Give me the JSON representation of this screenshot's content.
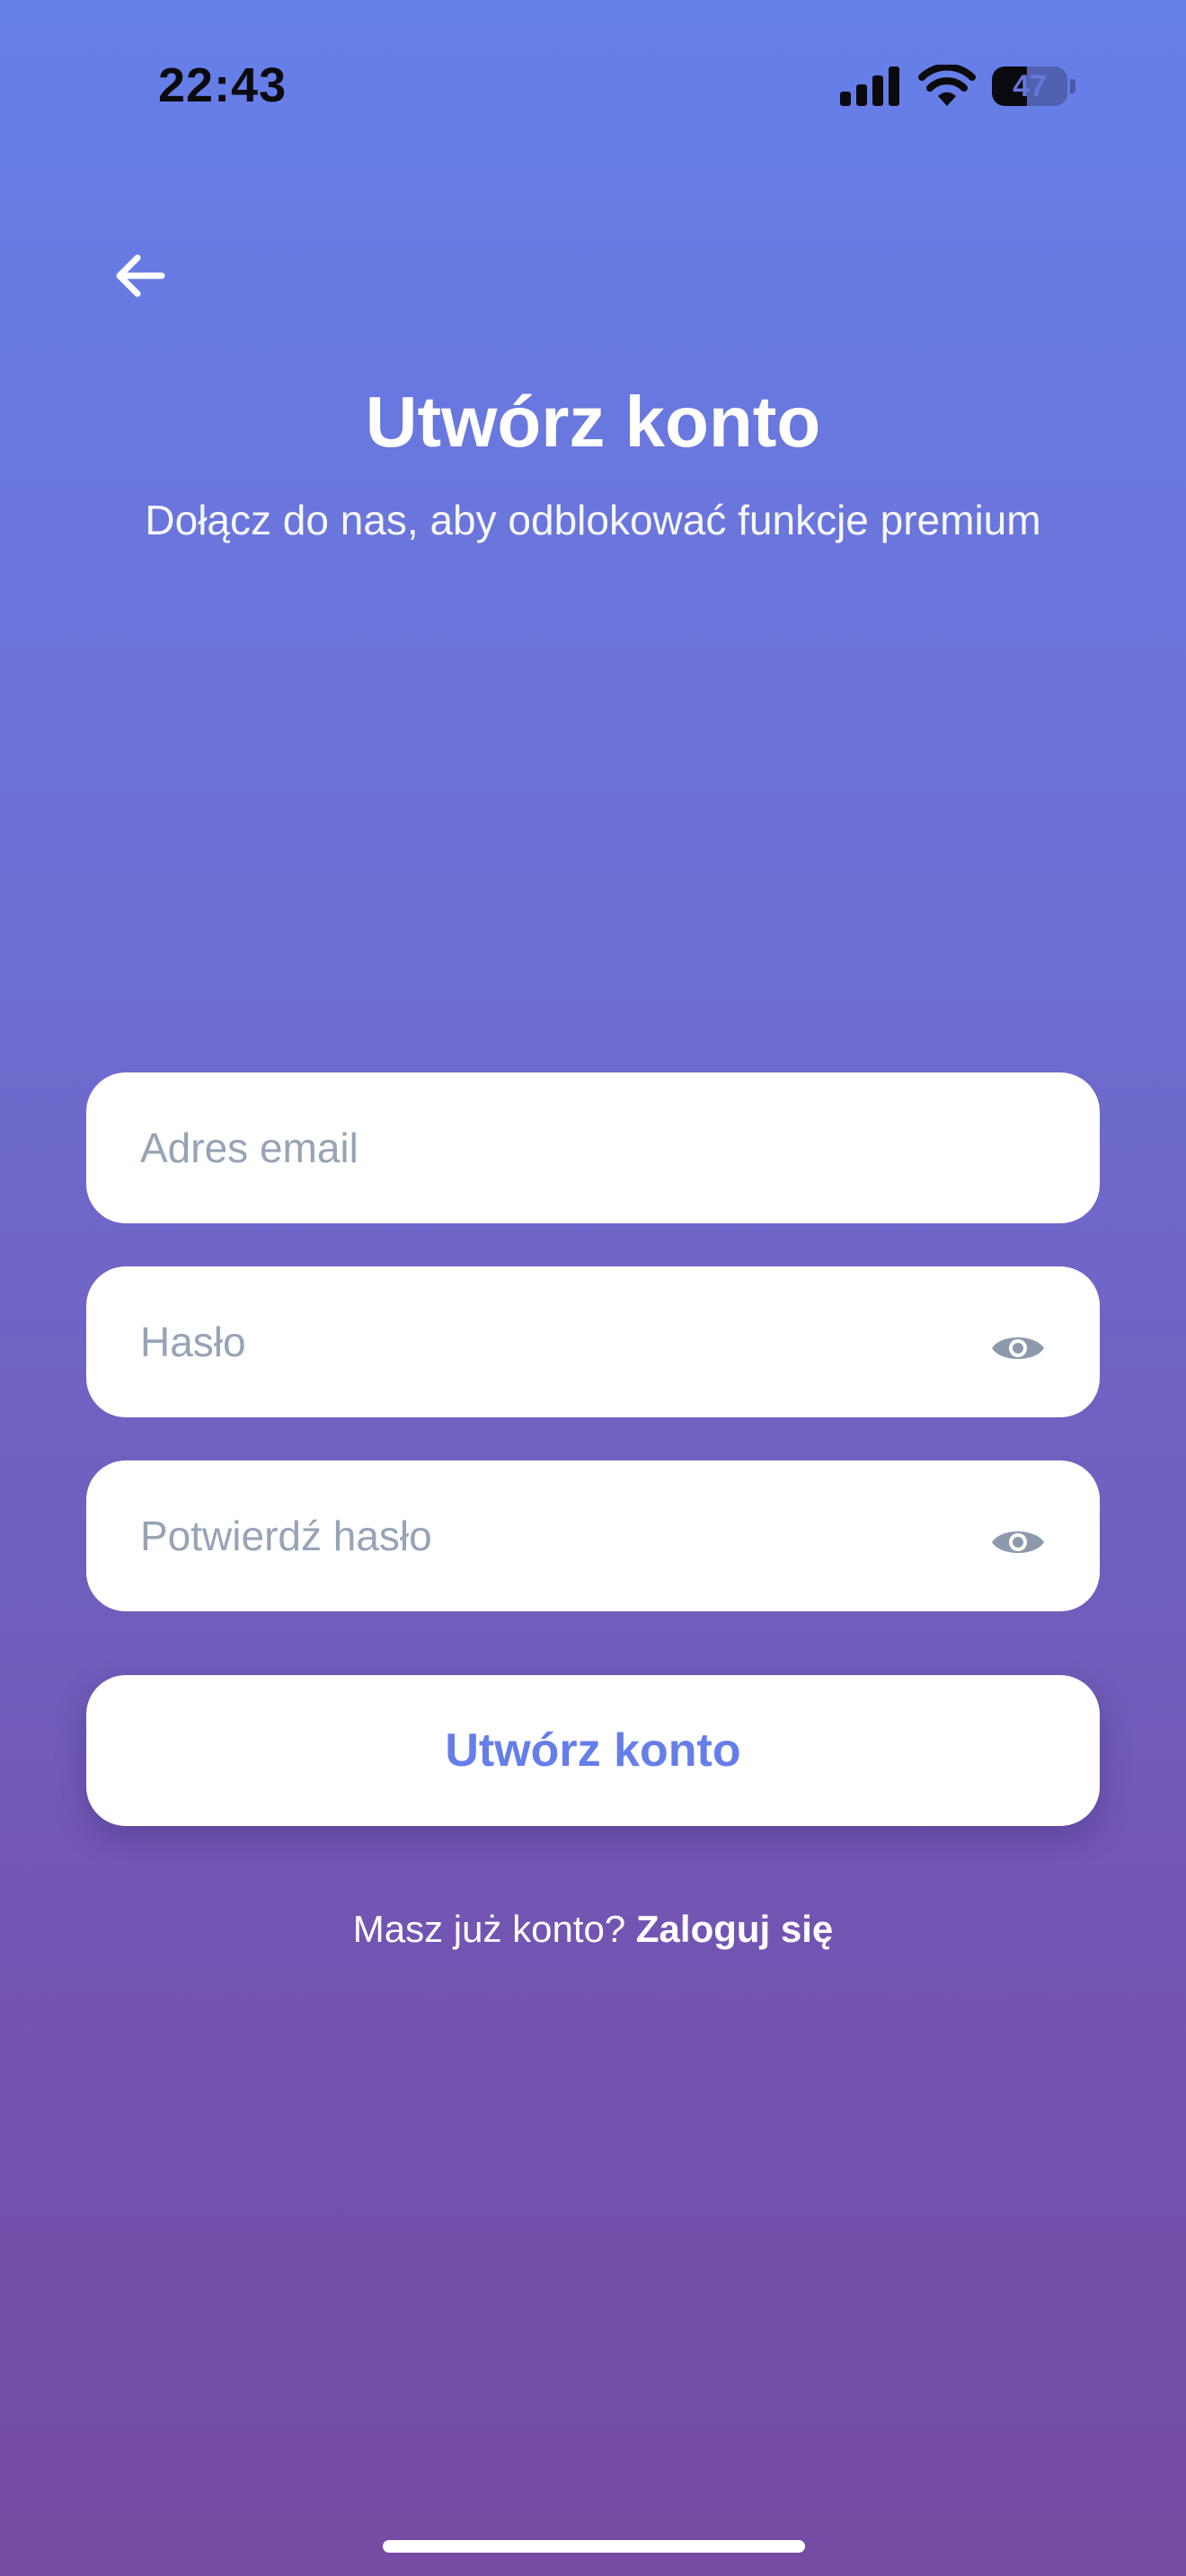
{
  "status_bar": {
    "time": "22:43",
    "battery_level": "47",
    "battery_fraction": 0.47,
    "icons": [
      "signal-icon",
      "wifi-icon",
      "battery-icon"
    ]
  },
  "header": {
    "back_icon": "arrow-left-icon",
    "title": "Utwórz konto",
    "subtitle": "Dołącz do nas, aby odblokować funkcje premium"
  },
  "form": {
    "email": {
      "placeholder": "Adres email",
      "value": ""
    },
    "password": {
      "placeholder": "Hasło",
      "value": "",
      "toggle_icon": "eye-icon"
    },
    "confirm_password": {
      "placeholder": "Potwierdź hasło",
      "value": "",
      "toggle_icon": "eye-icon"
    },
    "submit_label": "Utwórz konto"
  },
  "footer": {
    "prompt": "Masz już konto?",
    "link": "Zaloguj się"
  },
  "colors": {
    "gradient_top": "#6680EA",
    "gradient_bottom": "#764BA4",
    "accent": "#667EEA",
    "placeholder": "#97A3B6"
  }
}
